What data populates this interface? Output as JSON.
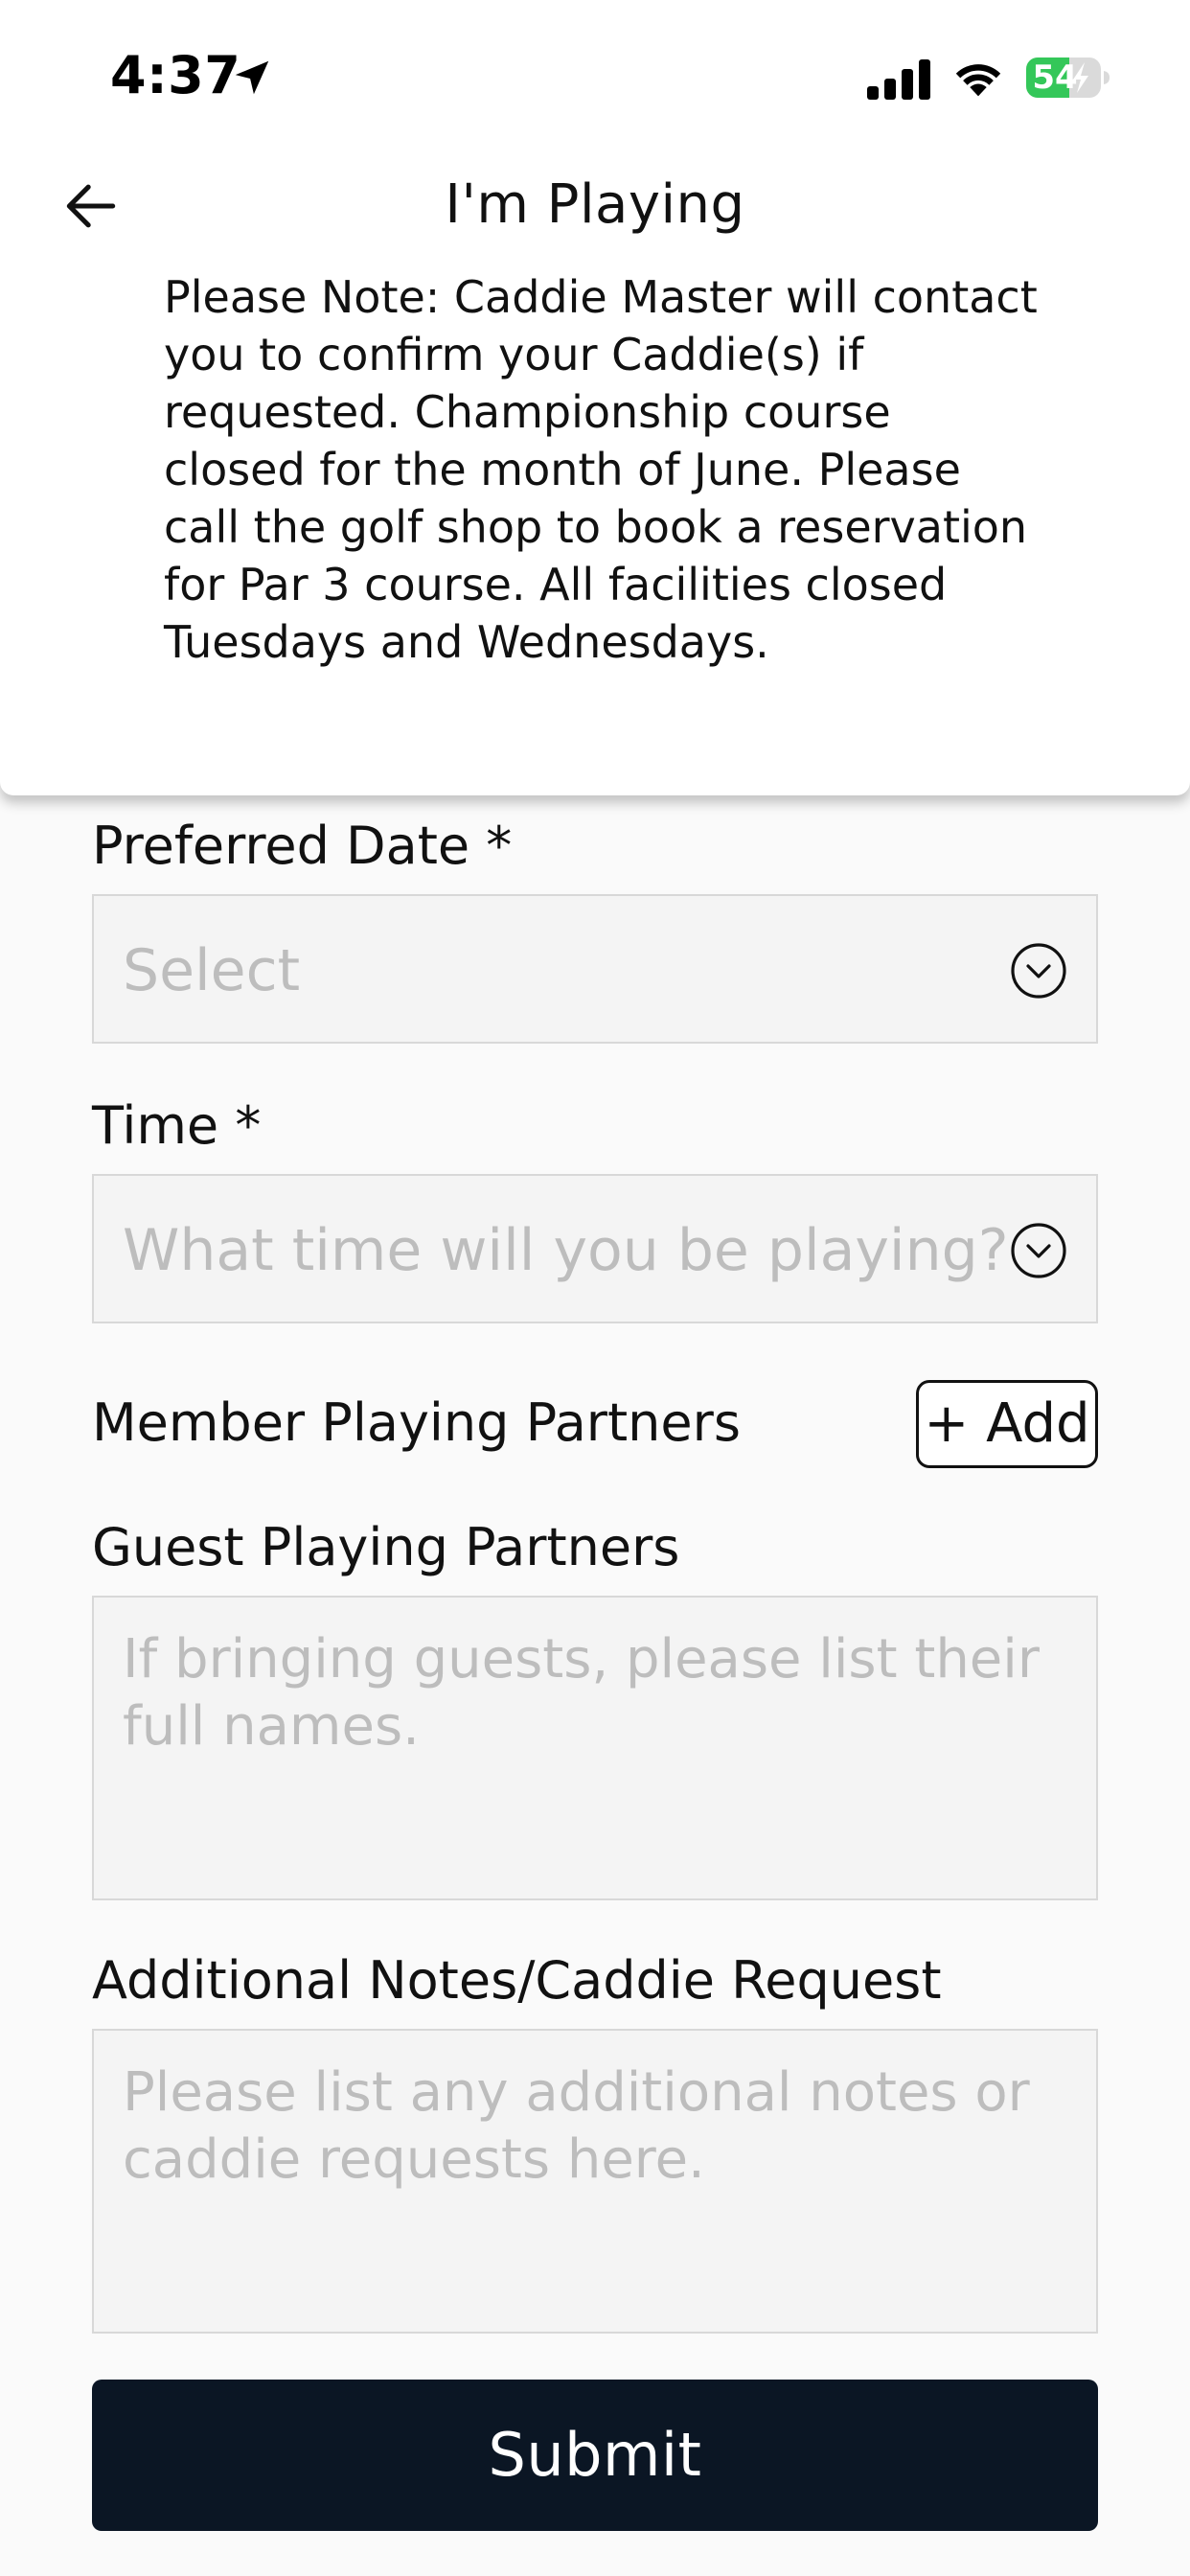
{
  "status_bar": {
    "time": "4:37",
    "battery_level": "54",
    "icons": [
      "location-arrow-icon",
      "signal-icon",
      "wifi-icon",
      "battery-charging-icon"
    ]
  },
  "header": {
    "title": "I'm Playing",
    "back_icon": "arrow-left-icon",
    "notice": "Please Note: Caddie Master will contact you to confirm your Caddie(s) if requested. Championship course closed for the month of June. Please call the golf shop to book a reservation for Par 3 course. All facilities closed Tuesdays and Wednesdays."
  },
  "form": {
    "preferred_date": {
      "label": "Preferred Date *",
      "placeholder": "Select",
      "icon": "chevron-down-circle-icon"
    },
    "time": {
      "label": "Time *",
      "placeholder": "What time will you be playing?",
      "icon": "chevron-down-circle-icon"
    },
    "member_partners": {
      "label": "Member Playing Partners",
      "add_label": "+ Add"
    },
    "guest_partners": {
      "label": "Guest Playing Partners",
      "placeholder": "If bringing guests, please list their full names."
    },
    "additional_notes": {
      "label": "Additional Notes/Caddie Request",
      "placeholder": "Please list any additional notes or caddie requests here."
    },
    "submit_label": "Submit"
  },
  "colors": {
    "submit_background": "#0B1624",
    "battery_green": "#34C759",
    "field_background": "#F4F4F4",
    "placeholder_text": "#BDBDBD"
  }
}
